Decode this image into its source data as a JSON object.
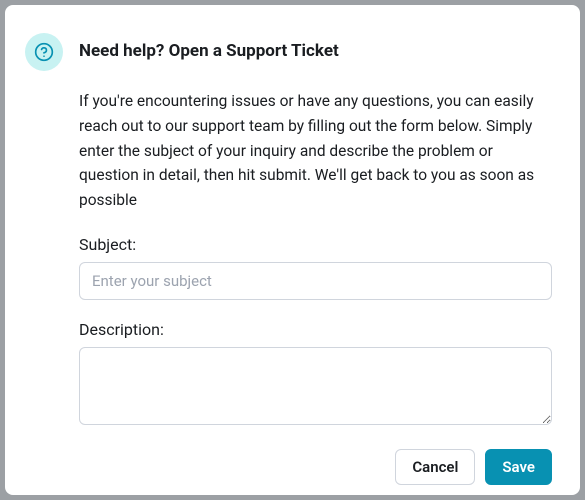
{
  "modal": {
    "title": "Need help? Open a Support Ticket",
    "description": "If you're encountering issues or have any questions, you can easily reach out to our support team by filling out the form below. Simply enter the subject of your inquiry and describe the problem or question in detail, then hit submit. We'll get back to you as soon as possible",
    "icon": "question-circle-icon"
  },
  "form": {
    "subject": {
      "label": "Subject:",
      "placeholder": "Enter your subject",
      "value": ""
    },
    "description_field": {
      "label": "Description:",
      "value": ""
    }
  },
  "buttons": {
    "cancel": "Cancel",
    "save": "Save"
  },
  "colors": {
    "accent": "#0891b2",
    "icon_bg": "#c8f2f2",
    "border": "#d0d5dd"
  }
}
